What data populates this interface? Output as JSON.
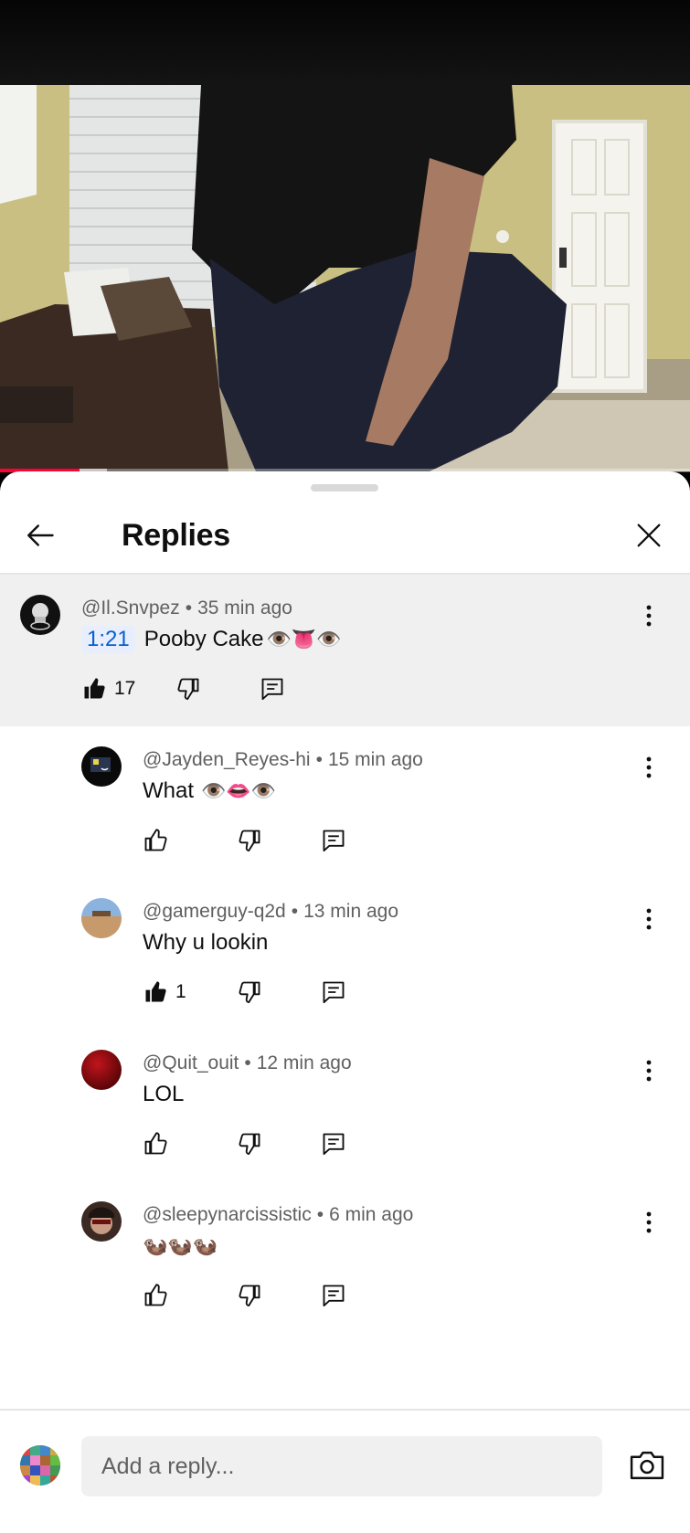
{
  "video": {
    "progress_played": 0.115,
    "progress_buffered": 0.155
  },
  "sheet": {
    "title": "Replies",
    "back_icon": "arrow-left-icon",
    "close_icon": "close-icon"
  },
  "parent_comment": {
    "author": "@Il.Snvpez",
    "time": "35 min ago",
    "timestamp_link": "1:21",
    "text": "Pooby Cake",
    "emojis": "👁️👅👁️",
    "likes": "17",
    "liked": true
  },
  "replies": [
    {
      "author": "@Jayden_Reyes-hi",
      "time": "15 min ago",
      "text": "What",
      "emojis": "👁️👄👁️",
      "likes": "",
      "liked": false
    },
    {
      "author": "@gamerguy-q2d",
      "time": "13 min ago",
      "text": "Why u lookin",
      "emojis": "",
      "likes": "1",
      "liked": true
    },
    {
      "author": "@Quit_ouit",
      "time": "12 min ago",
      "text": "LOL",
      "emojis": "",
      "likes": "",
      "liked": false
    },
    {
      "author": "@sleepynarcissistic",
      "time": "6 min ago",
      "text": "",
      "emojis": "🦦🦦🦦",
      "likes": "",
      "liked": false
    }
  ],
  "reply_bar": {
    "placeholder": "Add a reply...",
    "camera_icon": "camera-icon"
  },
  "separator": "•"
}
